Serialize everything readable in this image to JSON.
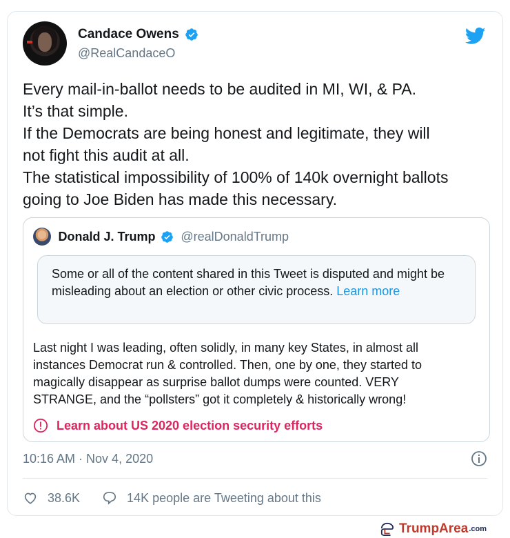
{
  "author": {
    "display_name": "Candace Owens",
    "handle": "@RealCandaceO",
    "verified": true
  },
  "brand_icon": "twitter-bird-icon",
  "tweet": {
    "lines": [
      "Every mail-in-ballot needs to be audited in MI, WI, & PA.",
      "It’s that simple.",
      "If the Democrats are being honest and legitimate, they will",
      "not fight this audit at all.",
      "The statistical impossibility of 100% of 140k overnight ballots",
      "going to Joe Biden has made this necessary."
    ]
  },
  "quoted_tweet": {
    "display_name": "Donald J. Trump",
    "handle": "@realDonaldTrump",
    "verified": true,
    "notice": {
      "text": "Some or all of the content shared in this Tweet is disputed and might be misleading about an election or other civic process.",
      "link": "Learn more"
    },
    "lines": [
      "Last night I was leading, often solidly, in many key States, in almost all",
      "instances Democrat run & controlled. Then, one by one, they started to",
      "magically disappear as surprise ballot dumps were counted. VERY",
      "STRANGE, and the “pollsters” got it completely & historically wrong!"
    ],
    "security_link": "Learn about US 2020 election security efforts"
  },
  "timestamp": "10:16 AM · Nov 4, 2020",
  "actions": {
    "likes": "38.6K",
    "conversation": "14K people are Tweeting about this"
  },
  "watermark": {
    "main": "TrumpArea",
    "tld": ".com"
  },
  "colors": {
    "verified_blue": "#1da1f2",
    "link_blue": "#1b95e0",
    "alert_red": "#e0245e",
    "secondary_gray": "#657786"
  }
}
